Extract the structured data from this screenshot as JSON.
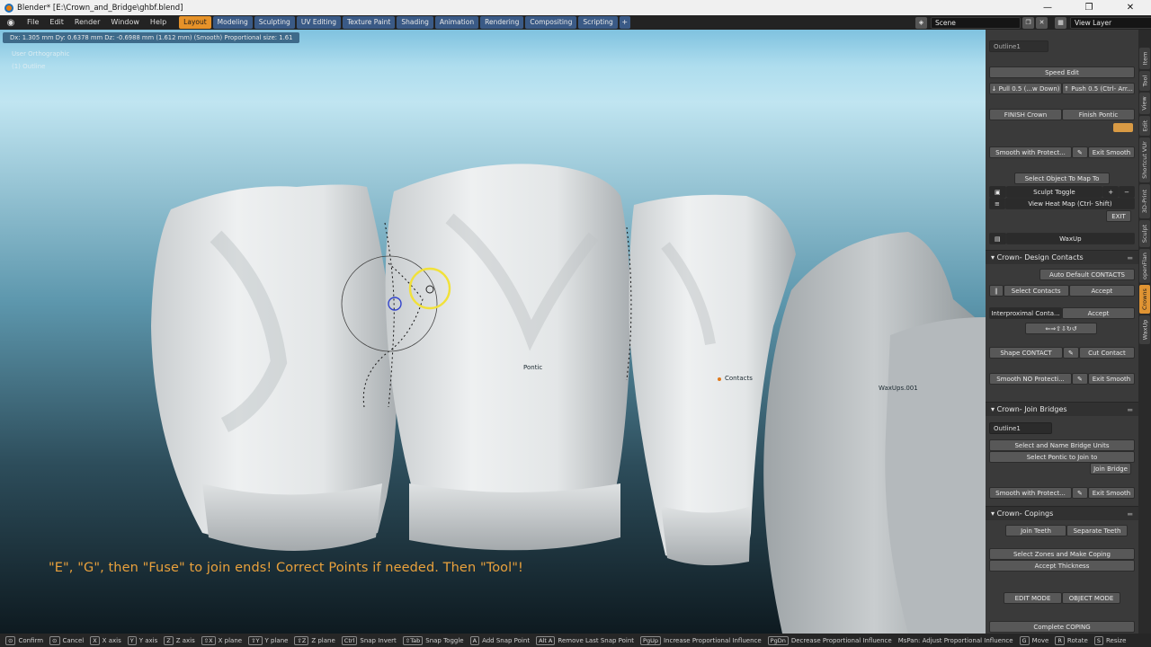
{
  "window": {
    "title": "Blender* [E:\\Crown_and_Bridge\\ghbf.blend]"
  },
  "topbar": {
    "menus": [
      "File",
      "Edit",
      "Render",
      "Window",
      "Help"
    ],
    "workspaces": [
      "Layout",
      "Modeling",
      "Sculpting",
      "UV Editing",
      "Texture Paint",
      "Shading",
      "Animation",
      "Rendering",
      "Compositing",
      "Scripting"
    ],
    "active_workspace": "Layout",
    "add_tab": "+",
    "scene": "Scene",
    "view_layer": "View Layer"
  },
  "viewport": {
    "status": "Dx: 1.305 mm   Dy: 0.6378 mm   Dz: -0.6988 mm (1.612 mm) (Smooth)   Proportional size: 1.61",
    "view_name": "User Orthographic",
    "object_name": "(1) Outline",
    "labels": {
      "pontic": "Pontic",
      "contacts": "Contacts",
      "waxups": "WaxUps.001"
    },
    "caption": "\"E\", \"G\", then \"Fuse\" to join ends! Correct Points if needed. Then \"Tool\"!"
  },
  "panel": {
    "top_field": "Outline1",
    "speed_edit": "Speed Edit",
    "pull": "↓ Pull 0.5 (...w Down)",
    "push": "↑ Push 0.5 (Ctrl- Arr...",
    "finish_crown": "FINISH Crown",
    "finish_pontic": "Finish Pontic",
    "smooth_protect": "Smooth with Protect...",
    "exit_smooth": "Exit Smooth",
    "select_map": "Select Object To Map To",
    "sculpt_toggle": "Sculpt Toggle",
    "heat_map": "View Heat Map (Ctrl- Shift)",
    "exit": "EXIT",
    "waxup": "WaxUp",
    "design_contacts_header": "Crown- Design Contacts",
    "auto_default": "Auto Default CONTACTS",
    "select_contacts": "Select Contacts",
    "accept": "Accept",
    "interproximal": "Interproximal Conta...",
    "accept2": "Accept",
    "shape_contact": "Shape CONTACT",
    "cut_contact": "Cut Contact",
    "smooth_no_protect": "Smooth NO Protecti...",
    "exit_smooth2": "Exit Smooth",
    "join_bridges_header": "Crown- Join Bridges",
    "outline_field": "Outline1",
    "select_name_bridge": "Select and Name Bridge Units",
    "select_pontic": "Select Pontic to Join to",
    "join_bridge": "Join Bridge",
    "smooth_protect2": "Smooth with Protect...",
    "exit_smooth3": "Exit Smooth",
    "copings_header": "Crown- Copings",
    "join_teeth": "Join Teeth",
    "separate_teeth": "Separate Teeth",
    "select_zones": "Select Zones and Make Coping",
    "accept_thickness": "Accept Thickness",
    "edit_mode": "EDIT MODE",
    "object_mode": "OBJECT MODE",
    "complete_coping": "Complete COPING"
  },
  "tabs": [
    "Item",
    "Tool",
    "View",
    "Edit",
    "Shortcut VUr",
    "3D-Print",
    "Sculpt",
    "openFlan",
    "Crowns",
    "WaxUp"
  ],
  "active_tab": "Crowns",
  "statusbar": [
    {
      "key": "⊙",
      "label": "Confirm"
    },
    {
      "key": "⊙",
      "label": "Cancel"
    },
    {
      "key": "X",
      "label": "X axis"
    },
    {
      "key": "Y",
      "label": "Y axis"
    },
    {
      "key": "Z",
      "label": "Z axis"
    },
    {
      "key": "⇧X",
      "label": "X plane"
    },
    {
      "key": "⇧Y",
      "label": "Y plane"
    },
    {
      "key": "⇧Z",
      "label": "Z plane"
    },
    {
      "key": "Ctrl",
      "label": "Snap Invert"
    },
    {
      "key": "⇧Tab",
      "label": "Snap Toggle"
    },
    {
      "key": "A",
      "label": "Add Snap Point"
    },
    {
      "key": "Alt A",
      "label": "Remove Last Snap Point"
    },
    {
      "key": "PgUp",
      "label": "Increase Proportional Influence"
    },
    {
      "key": "PgDn",
      "label": "Decrease Proportional Influence"
    },
    {
      "key": "",
      "label": "MsPan: Adjust Proportional Influence"
    },
    {
      "key": "G",
      "label": "Move"
    },
    {
      "key": "R",
      "label": "Rotate"
    },
    {
      "key": "S",
      "label": "Resize"
    }
  ],
  "colors": {
    "accent": "#e69229",
    "tab_blue": "#3a5a86",
    "caption": "#e9a13c"
  }
}
